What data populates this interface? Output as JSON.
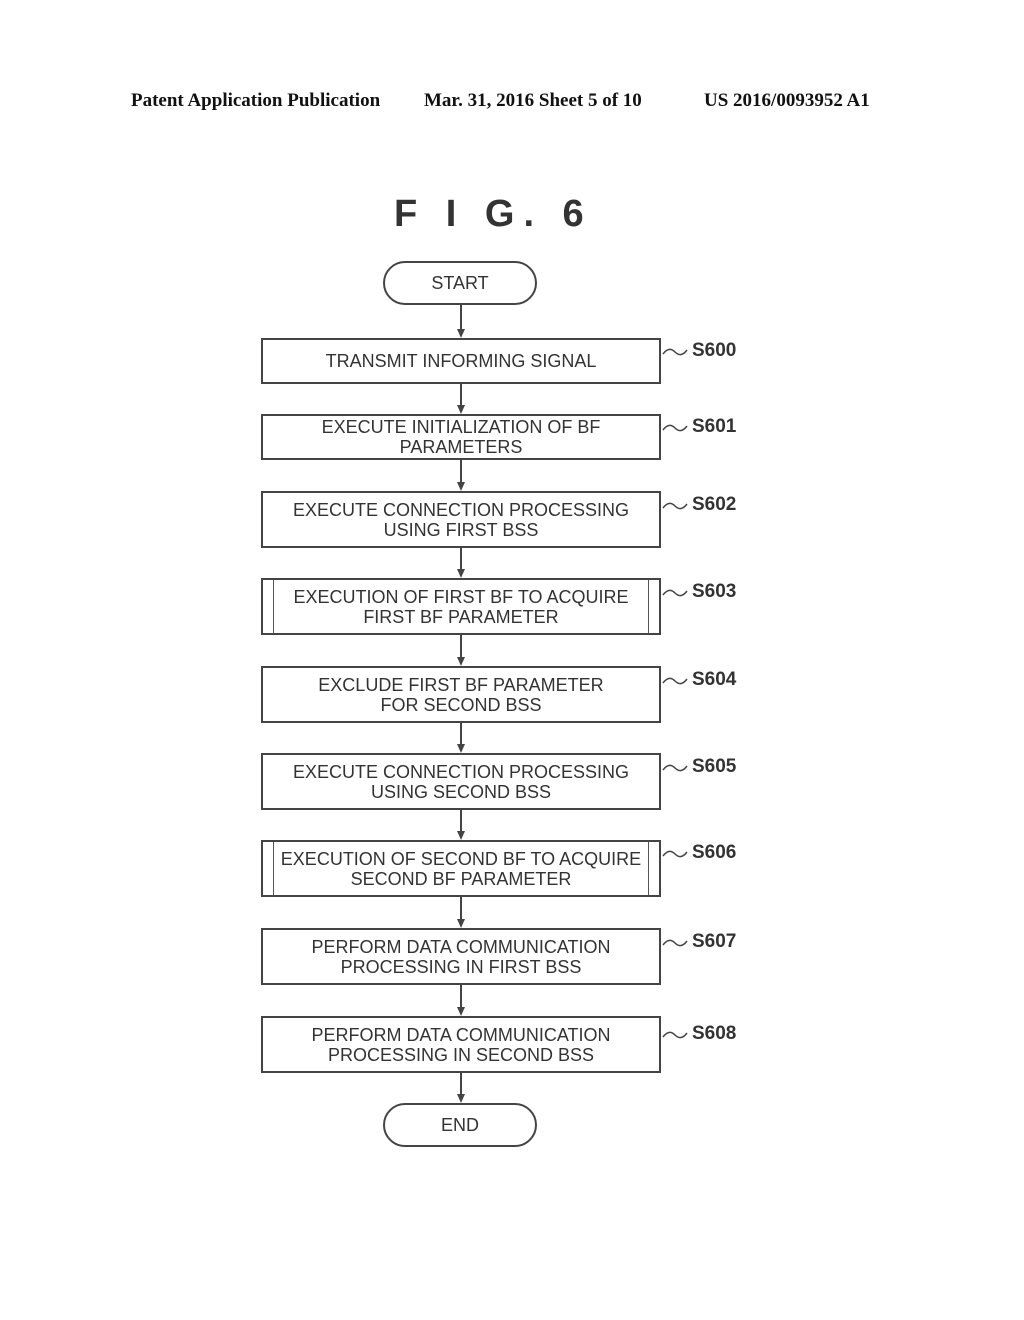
{
  "header": {
    "publication": "Patent Application Publication",
    "date_sheet": "Mar. 31, 2016  Sheet 5 of 10",
    "number": "US 2016/0093952 A1"
  },
  "figure": {
    "title": "F I G. 6",
    "start": "START",
    "end": "END",
    "steps": [
      {
        "id": "S600",
        "line1": "TRANSMIT INFORMING SIGNAL",
        "line2": "",
        "subroutine": false
      },
      {
        "id": "S601",
        "line1": "EXECUTE INITIALIZATION OF BF PARAMETERS",
        "line2": "",
        "subroutine": false
      },
      {
        "id": "S602",
        "line1": "EXECUTE CONNECTION PROCESSING",
        "line2": "USING FIRST BSS",
        "subroutine": false
      },
      {
        "id": "S603",
        "line1": "EXECUTION OF FIRST BF TO ACQUIRE",
        "line2": "FIRST BF PARAMETER",
        "subroutine": true
      },
      {
        "id": "S604",
        "line1": "EXCLUDE FIRST BF PARAMETER",
        "line2": "FOR SECOND BSS",
        "subroutine": false
      },
      {
        "id": "S605",
        "line1": "EXECUTE CONNECTION PROCESSING",
        "line2": "USING SECOND BSS",
        "subroutine": false
      },
      {
        "id": "S606",
        "line1": "EXECUTION OF SECOND BF TO ACQUIRE",
        "line2": "SECOND BF PARAMETER",
        "subroutine": true
      },
      {
        "id": "S607",
        "line1": "PERFORM DATA COMMUNICATION",
        "line2": "PROCESSING IN FIRST BSS",
        "subroutine": false
      },
      {
        "id": "S608",
        "line1": "PERFORM DATA COMMUNICATION",
        "line2": "PROCESSING IN SECOND BSS",
        "subroutine": false
      }
    ]
  }
}
